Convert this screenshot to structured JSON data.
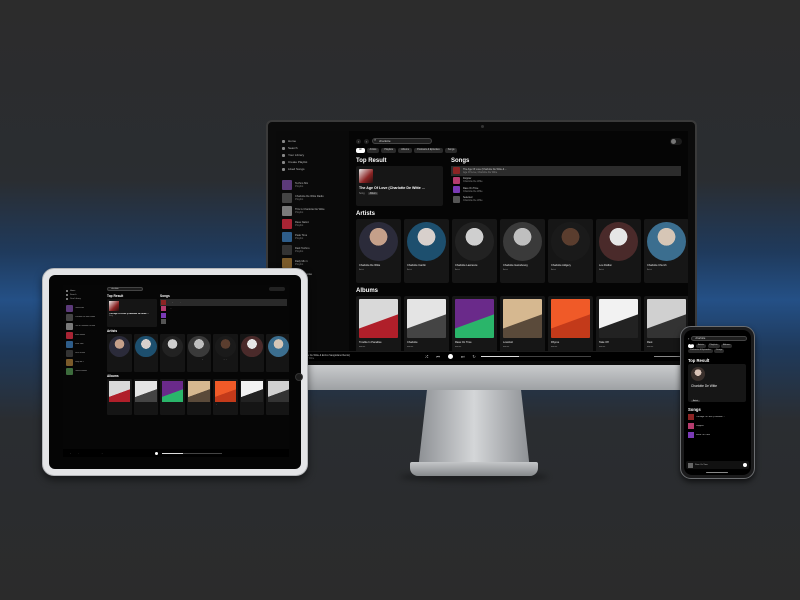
{
  "colors": {
    "accent": "#ffffff",
    "background": "#000000",
    "card": "#161616",
    "brand_glow": "#245086"
  },
  "search_query": "charlotte",
  "desktop": {
    "nav": [
      "Home",
      "Search",
      "Your Library",
      "Create Playlist",
      "Liked Songs"
    ],
    "playlists": [
      {
        "title": "Techno Mix",
        "sub": "Playlist",
        "color": "#5c3a7a"
      },
      {
        "title": "Charlotte De Witte Radio",
        "sub": "Playlist",
        "color": "#444"
      },
      {
        "title": "This Is Charlotte De Witte",
        "sub": "Playlist",
        "color": "#7a7a7a"
      },
      {
        "title": "Rave Nation",
        "sub": "Playlist",
        "color": "#a82434"
      },
      {
        "title": "Peak Time",
        "sub": "Playlist",
        "color": "#2e5d8a"
      },
      {
        "title": "Dark Techno",
        "sub": "Playlist",
        "color": "#333"
      },
      {
        "title": "Daily Mix 1",
        "sub": "Playlist",
        "color": "#7a5a2a"
      },
      {
        "title": "Techno Bunker",
        "sub": "Playlist",
        "color": "#3c6b3c"
      }
    ],
    "user_name": "",
    "chips": [
      "All",
      "Artists",
      "Playlists",
      "Albums",
      "Podcasts & Episodes",
      "Songs"
    ],
    "headings": {
      "top_result": "Top Result",
      "songs": "Songs",
      "artists": "Artists",
      "albums": "Albums"
    },
    "top_result": {
      "title": "The Age Of Love (Charlotte De Witte ...",
      "type": "Song",
      "badge": "Album"
    },
    "songs": [
      {
        "title": "The Age Of Love (Charlotte De Witte & ...",
        "artist": "Age Of Love, Charlotte De Witte",
        "duration": "",
        "color": "#8c2424"
      },
      {
        "title": "Doppler",
        "artist": "Charlotte De Witte",
        "duration": "",
        "color": "#b53c6e"
      },
      {
        "title": "Rave On Time",
        "artist": "Charlotte De Witte",
        "duration": "",
        "color": "#7a3ab5"
      },
      {
        "title": "Selected",
        "artist": "Charlotte De Witte",
        "duration": "",
        "color": "#555"
      }
    ],
    "artists": [
      {
        "name": "Charlotte De Witte",
        "role": "Artist",
        "c1": "#c5a08a",
        "c2": "#2b2b3a"
      },
      {
        "name": "Charlotte Cardin",
        "role": "Artist",
        "c1": "#d8d0cc",
        "c2": "#1d4f6e"
      },
      {
        "name": "Charlotte Lawrence",
        "role": "Artist",
        "c1": "#cfcfcf",
        "c2": "#222"
      },
      {
        "name": "Charlotte Gainsbourg",
        "role": "Artist",
        "c1": "#bfbfbf",
        "c2": "#3a3a3a"
      },
      {
        "name": "Charlotte Adigery",
        "role": "Artist",
        "c1": "#5a3d2e",
        "c2": "#1a1a1a"
      },
      {
        "name": "Lou Doillon",
        "role": "Artist",
        "c1": "#e6e6e6",
        "c2": "#4a2a2a"
      },
      {
        "name": "Charlotte Church",
        "role": "Artist",
        "c1": "#d6c6b6",
        "c2": "#3b6e8f"
      }
    ],
    "albums": [
      {
        "name": "Trouble In Paradise",
        "year": "Album",
        "c1": "#d9d9d9",
        "c2": "#b01f2a"
      },
      {
        "name": "Charlotte",
        "year": "Album",
        "c1": "#e4e4e4",
        "c2": "#444"
      },
      {
        "name": "Rave On Time",
        "year": "Album",
        "c1": "#6a2a8a",
        "c2": "#2ab56a"
      },
      {
        "name": "Lovefool",
        "year": "Album",
        "c1": "#d6b890",
        "c2": "#5a4a3a"
      },
      {
        "name": "Rhyme",
        "year": "Album",
        "c1": "#f05a28",
        "c2": "#c33a1a"
      },
      {
        "name": "Take Off",
        "year": "Album",
        "c1": "#f2f2f2",
        "c2": "#222"
      },
      {
        "name": "Rest",
        "year": "Album",
        "c1": "#d0d0d0",
        "c2": "#333"
      }
    ],
    "now_playing": {
      "title": "The Age Of Love (Charlotte De Witte & Enrico Sangiuliano Remix)",
      "artist": "Age Of Love, Charlotte De Witte",
      "progress": 0.35
    }
  },
  "tablet": {
    "nav": [
      "Home",
      "Search",
      "Your Library"
    ],
    "user_name": ""
  },
  "phone": {
    "back_icon": "back-arrow-icon",
    "chips": [
      "All",
      "Artists",
      "Playlists",
      "Albums",
      "Podcasts & Episodes",
      "Songs"
    ],
    "top_result_heading": "Top Result",
    "top_result_name": "Charlotte De Witte",
    "top_result_badge": "Artist",
    "songs_heading": "Songs",
    "songs": [
      {
        "title": "The Age Of Love (Charlotte ...",
        "color": "#8c2424"
      },
      {
        "title": "Doppler",
        "color": "#b53c6e"
      },
      {
        "title": "Rave On Time",
        "color": "#7a3ab5"
      }
    ],
    "now_playing": "Rave On Time"
  }
}
